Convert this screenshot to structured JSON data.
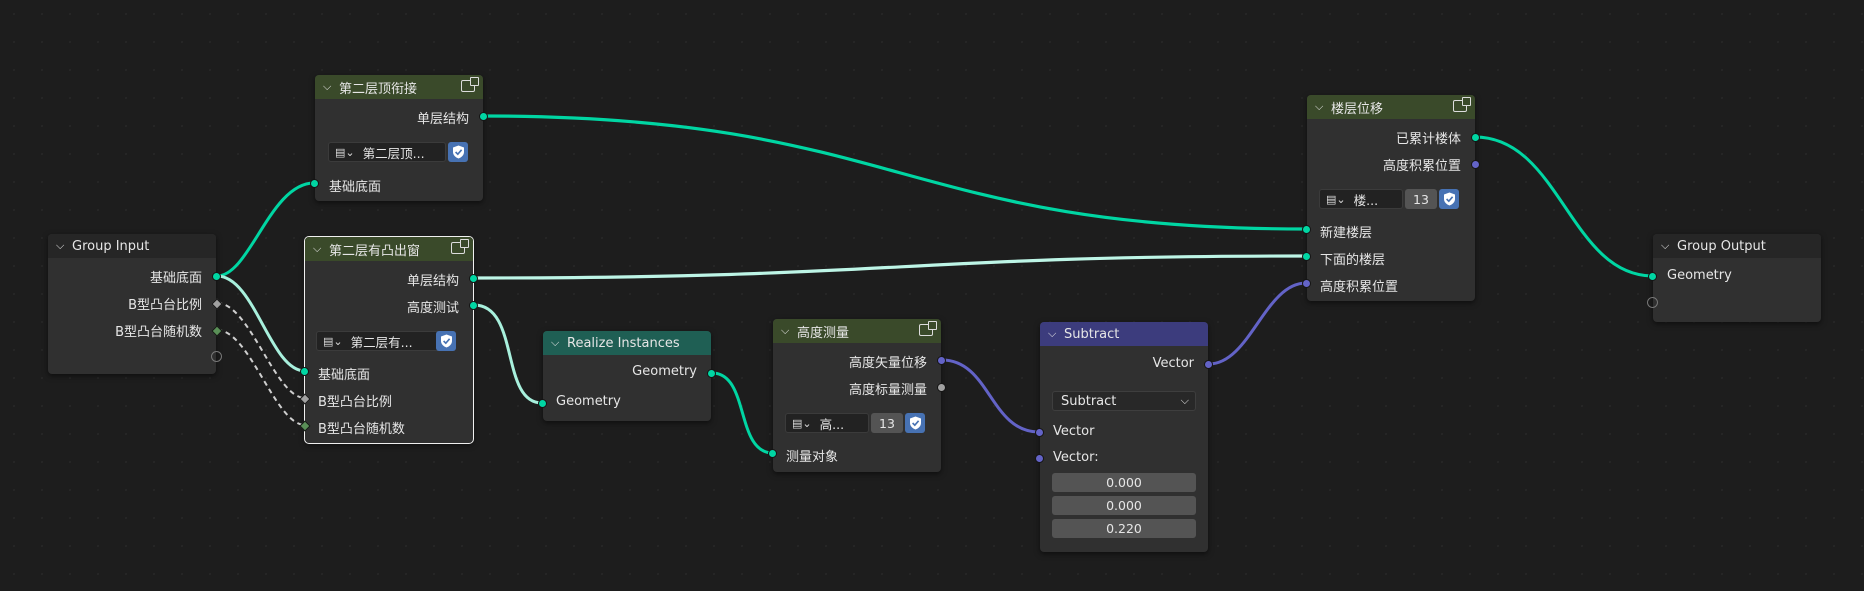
{
  "colors": {
    "geometry": "#00d6a3",
    "vector": "#6363c7",
    "float": "#a1a1a1",
    "geo_header": "#3a4a2a",
    "vector_header": "#3c3c7d",
    "realize_header": "#1f5f54"
  },
  "nodes": {
    "group_input": {
      "title": "Group Input",
      "outputs": [
        "基础底面",
        "B型凸台比例",
        "B型凸台随机数"
      ]
    },
    "node_top": {
      "title": "第二层顶衔接",
      "output": "单层结构",
      "group_name": "第二层顶...",
      "input": "基础底面"
    },
    "node_window": {
      "title": "第二层有凸出窗",
      "outputs": [
        "单层结构",
        "高度测试"
      ],
      "group_name": "第二层有...",
      "inputs": [
        "基础底面",
        "B型凸台比例",
        "B型凸台随机数"
      ]
    },
    "realize": {
      "title": "Realize Instances",
      "output": "Geometry",
      "input": "Geometry"
    },
    "measure": {
      "title": "高度测量",
      "outputs": [
        "高度矢量位移",
        "高度标量测量"
      ],
      "group_name": "高...",
      "users": "13",
      "input": "测量对象"
    },
    "subtract": {
      "title": "Subtract",
      "output": "Vector",
      "operation": "Subtract",
      "inputs": [
        "Vector",
        "Vector:"
      ],
      "values": [
        "0.000",
        "0.000",
        "0.220"
      ]
    },
    "floor": {
      "title": "楼层位移",
      "outputs": [
        "已累计楼体",
        "高度积累位置"
      ],
      "group_name": "楼...",
      "users": "13",
      "inputs": [
        "新建楼层",
        "下面的楼层",
        "高度积累位置"
      ]
    },
    "group_output": {
      "title": "Group Output",
      "input": "Geometry"
    }
  }
}
